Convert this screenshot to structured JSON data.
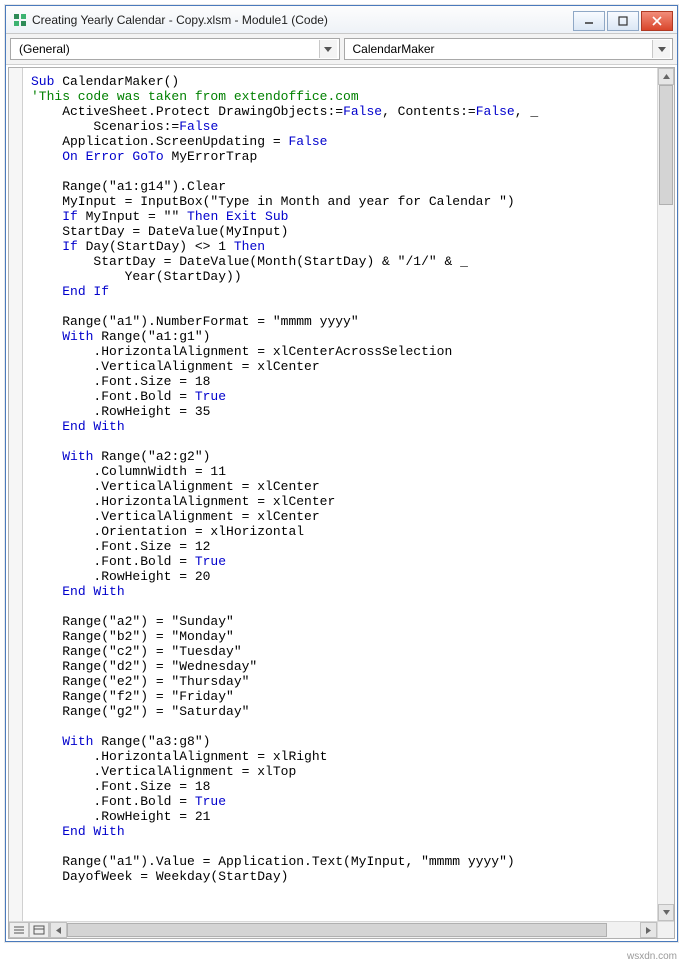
{
  "window": {
    "title": "Creating Yearly Calendar - Copy.xlsm - Module1 (Code)"
  },
  "dropdowns": {
    "object": "(General)",
    "procedure": "CalendarMaker"
  },
  "code": {
    "lines": [
      {
        "t": "kw",
        "s": "Sub "
      },
      {
        "t": "",
        "s": "CalendarMaker()"
      },
      {
        "nl": 1
      },
      {
        "t": "cm",
        "s": "'This code was taken from extendoffice.com"
      },
      {
        "nl": 1
      },
      {
        "t": "",
        "s": "    ActiveSheet.Protect DrawingObjects:="
      },
      {
        "t": "kw",
        "s": "False"
      },
      {
        "t": "",
        "s": ", Contents:="
      },
      {
        "t": "kw",
        "s": "False"
      },
      {
        "t": "",
        "s": ", _"
      },
      {
        "nl": 1
      },
      {
        "t": "",
        "s": "        Scenarios:="
      },
      {
        "t": "kw",
        "s": "False"
      },
      {
        "nl": 1
      },
      {
        "t": "",
        "s": "    Application.ScreenUpdating = "
      },
      {
        "t": "kw",
        "s": "False"
      },
      {
        "nl": 1
      },
      {
        "t": "",
        "s": "    "
      },
      {
        "t": "kw",
        "s": "On Error GoTo"
      },
      {
        "t": "",
        "s": " MyErrorTrap"
      },
      {
        "nl": 1
      },
      {
        "nl": 1
      },
      {
        "t": "",
        "s": "    Range(\"a1:g14\").Clear"
      },
      {
        "nl": 1
      },
      {
        "t": "",
        "s": "    MyInput = InputBox(\"Type in Month and year for Calendar \")"
      },
      {
        "nl": 1
      },
      {
        "t": "",
        "s": "    "
      },
      {
        "t": "kw",
        "s": "If"
      },
      {
        "t": "",
        "s": " MyInput = \"\" "
      },
      {
        "t": "kw",
        "s": "Then Exit Sub"
      },
      {
        "nl": 1
      },
      {
        "t": "",
        "s": "    StartDay = DateValue(MyInput)"
      },
      {
        "nl": 1
      },
      {
        "t": "",
        "s": "    "
      },
      {
        "t": "kw",
        "s": "If"
      },
      {
        "t": "",
        "s": " Day(StartDay) <> 1 "
      },
      {
        "t": "kw",
        "s": "Then"
      },
      {
        "nl": 1
      },
      {
        "t": "",
        "s": "        StartDay = DateValue(Month(StartDay) & \"/1/\" & _"
      },
      {
        "nl": 1
      },
      {
        "t": "",
        "s": "            Year(StartDay))"
      },
      {
        "nl": 1
      },
      {
        "t": "",
        "s": "    "
      },
      {
        "t": "kw",
        "s": "End If"
      },
      {
        "nl": 1
      },
      {
        "nl": 1
      },
      {
        "t": "",
        "s": "    Range(\"a1\").NumberFormat = \"mmmm yyyy\""
      },
      {
        "nl": 1
      },
      {
        "t": "",
        "s": "    "
      },
      {
        "t": "kw",
        "s": "With"
      },
      {
        "t": "",
        "s": " Range(\"a1:g1\")"
      },
      {
        "nl": 1
      },
      {
        "t": "",
        "s": "        .HorizontalAlignment = xlCenterAcrossSelection"
      },
      {
        "nl": 1
      },
      {
        "t": "",
        "s": "        .VerticalAlignment = xlCenter"
      },
      {
        "nl": 1
      },
      {
        "t": "",
        "s": "        .Font.Size = 18"
      },
      {
        "nl": 1
      },
      {
        "t": "",
        "s": "        .Font.Bold = "
      },
      {
        "t": "kw",
        "s": "True"
      },
      {
        "nl": 1
      },
      {
        "t": "",
        "s": "        .RowHeight = 35"
      },
      {
        "nl": 1
      },
      {
        "t": "",
        "s": "    "
      },
      {
        "t": "kw",
        "s": "End With"
      },
      {
        "nl": 1
      },
      {
        "nl": 1
      },
      {
        "t": "",
        "s": "    "
      },
      {
        "t": "kw",
        "s": "With"
      },
      {
        "t": "",
        "s": " Range(\"a2:g2\")"
      },
      {
        "nl": 1
      },
      {
        "t": "",
        "s": "        .ColumnWidth = 11"
      },
      {
        "nl": 1
      },
      {
        "t": "",
        "s": "        .VerticalAlignment = xlCenter"
      },
      {
        "nl": 1
      },
      {
        "t": "",
        "s": "        .HorizontalAlignment = xlCenter"
      },
      {
        "nl": 1
      },
      {
        "t": "",
        "s": "        .VerticalAlignment = xlCenter"
      },
      {
        "nl": 1
      },
      {
        "t": "",
        "s": "        .Orientation = xlHorizontal"
      },
      {
        "nl": 1
      },
      {
        "t": "",
        "s": "        .Font.Size = 12"
      },
      {
        "nl": 1
      },
      {
        "t": "",
        "s": "        .Font.Bold = "
      },
      {
        "t": "kw",
        "s": "True"
      },
      {
        "nl": 1
      },
      {
        "t": "",
        "s": "        .RowHeight = 20"
      },
      {
        "nl": 1
      },
      {
        "t": "",
        "s": "    "
      },
      {
        "t": "kw",
        "s": "End With"
      },
      {
        "nl": 1
      },
      {
        "nl": 1
      },
      {
        "t": "",
        "s": "    Range(\"a2\") = \"Sunday\""
      },
      {
        "nl": 1
      },
      {
        "t": "",
        "s": "    Range(\"b2\") = \"Monday\""
      },
      {
        "nl": 1
      },
      {
        "t": "",
        "s": "    Range(\"c2\") = \"Tuesday\""
      },
      {
        "nl": 1
      },
      {
        "t": "",
        "s": "    Range(\"d2\") = \"Wednesday\""
      },
      {
        "nl": 1
      },
      {
        "t": "",
        "s": "    Range(\"e2\") = \"Thursday\""
      },
      {
        "nl": 1
      },
      {
        "t": "",
        "s": "    Range(\"f2\") = \"Friday\""
      },
      {
        "nl": 1
      },
      {
        "t": "",
        "s": "    Range(\"g2\") = \"Saturday\""
      },
      {
        "nl": 1
      },
      {
        "nl": 1
      },
      {
        "t": "",
        "s": "    "
      },
      {
        "t": "kw",
        "s": "With"
      },
      {
        "t": "",
        "s": " Range(\"a3:g8\")"
      },
      {
        "nl": 1
      },
      {
        "t": "",
        "s": "        .HorizontalAlignment = xlRight"
      },
      {
        "nl": 1
      },
      {
        "t": "",
        "s": "        .VerticalAlignment = xlTop"
      },
      {
        "nl": 1
      },
      {
        "t": "",
        "s": "        .Font.Size = 18"
      },
      {
        "nl": 1
      },
      {
        "t": "",
        "s": "        .Font.Bold = "
      },
      {
        "t": "kw",
        "s": "True"
      },
      {
        "nl": 1
      },
      {
        "t": "",
        "s": "        .RowHeight = 21"
      },
      {
        "nl": 1
      },
      {
        "t": "",
        "s": "    "
      },
      {
        "t": "kw",
        "s": "End With"
      },
      {
        "nl": 1
      },
      {
        "nl": 1
      },
      {
        "t": "",
        "s": "    Range(\"a1\").Value = Application.Text(MyInput, \"mmmm yyyy\")"
      },
      {
        "nl": 1
      },
      {
        "t": "",
        "s": "    DayofWeek = Weekday(StartDay)"
      },
      {
        "nl": 1
      }
    ]
  },
  "watermark": "wsxdn.com"
}
